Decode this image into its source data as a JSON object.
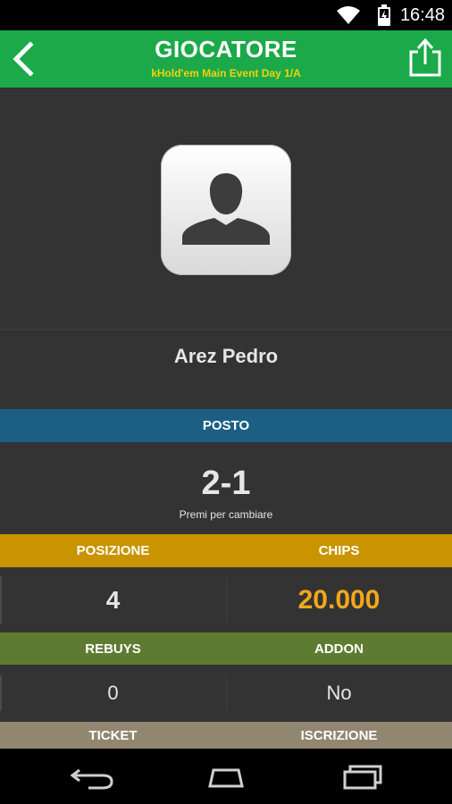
{
  "status_bar": {
    "time": "16:48",
    "icons": [
      "wifi-icon",
      "battery-charging-icon"
    ]
  },
  "header": {
    "title": "GIOCATORE",
    "subtitle": "kHold'em Main Event Day 1/A",
    "back_icon": "chevron-left-icon",
    "share_icon": "share-icon",
    "background_color": "#1ca94a",
    "subtitle_color": "#f2d20b"
  },
  "player": {
    "avatar_icon": "person-silhouette-icon",
    "name": "Arez Pedro"
  },
  "seat": {
    "label": "POSTO",
    "value": "2-1",
    "hint": "Premi per cambiare",
    "band_color": "#1c5f83"
  },
  "stats": {
    "position_label": "POSIZIONE",
    "position_value": "4",
    "chips_label": "CHIPS",
    "chips_value": "20.000",
    "band_color": "#c99400",
    "chips_color": "#f2a71b"
  },
  "extras": {
    "rebuys_label": "REBUYS",
    "rebuys_value": "0",
    "addon_label": "ADDON",
    "addon_value": "No",
    "band_color": "#5e7c31"
  },
  "more": {
    "ticket_label": "TICKET",
    "iscrizione_label": "ISCRIZIONE",
    "band_color": "#918770"
  },
  "nav_bar": {
    "icons": [
      "back-nav-icon",
      "home-nav-icon",
      "recent-apps-icon"
    ]
  }
}
